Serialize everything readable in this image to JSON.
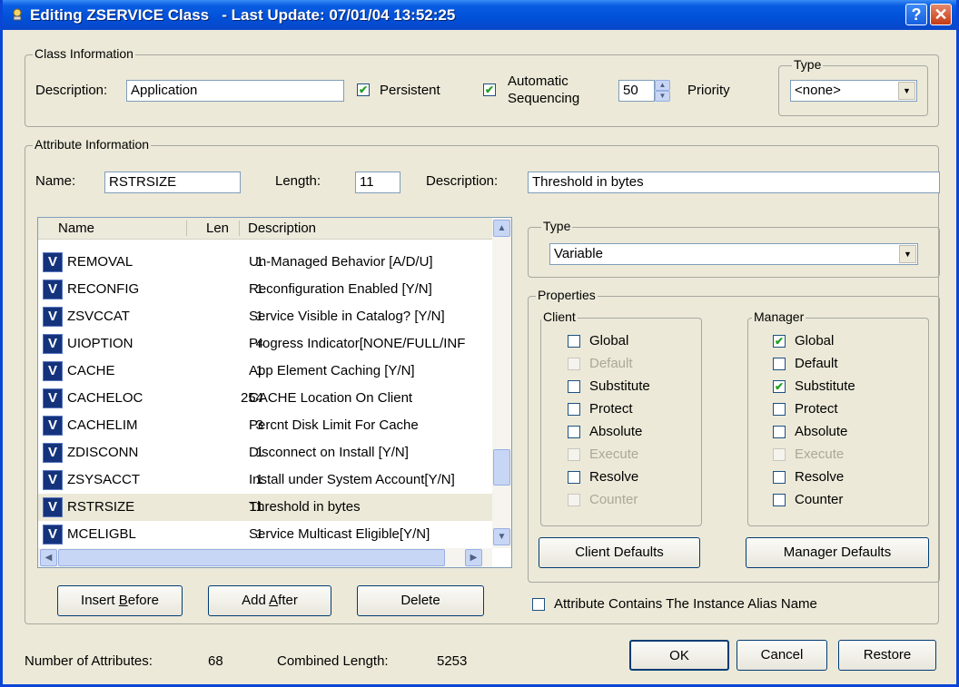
{
  "window": {
    "title": "Editing ZSERVICE Class   - Last Update: 07/01/04 13:52:25",
    "help_glyph": "?",
    "close_glyph": "✕"
  },
  "class_info": {
    "legend": "Class Information",
    "description_label": "Description:",
    "description_value": "Application",
    "persistent_label": "Persistent",
    "persistent_checked": true,
    "auto_seq_label_1": "Automatic",
    "auto_seq_label_2": "Sequencing",
    "auto_seq_checked": true,
    "priority_value": "50",
    "priority_label": "Priority",
    "type_legend": "Type",
    "type_value": "<none>"
  },
  "attr_info": {
    "legend": "Attribute Information",
    "name_label": "Name:",
    "name_value": "RSTRSIZE",
    "length_label": "Length:",
    "length_value": "11",
    "description_label": "Description:",
    "description_value": "Threshold in bytes"
  },
  "list": {
    "columns": [
      "Name",
      "Len",
      "Description"
    ],
    "rows": [
      {
        "icon": "V",
        "name": "REMOVAL",
        "len": "1",
        "desc": "Un-Managed Behavior [A/D/U]"
      },
      {
        "icon": "V",
        "name": "RECONFIG",
        "len": "1",
        "desc": "Reconfiguration  Enabled [Y/N]"
      },
      {
        "icon": "V",
        "name": "ZSVCCAT",
        "len": "1",
        "desc": "Service Visible in Catalog?  [Y/N]"
      },
      {
        "icon": "V",
        "name": "UIOPTION",
        "len": "4",
        "desc": "Progress Indicator[NONE/FULL/INF"
      },
      {
        "icon": "V",
        "name": "CACHE",
        "len": "1",
        "desc": "App Element Caching [Y/N]"
      },
      {
        "icon": "V",
        "name": "CACHELOC",
        "len": "254",
        "desc": "CACHE Location On Client"
      },
      {
        "icon": "V",
        "name": "CACHELIM",
        "len": "3",
        "desc": "Percnt Disk Limit For Cache"
      },
      {
        "icon": "V",
        "name": "ZDISCONN",
        "len": "1",
        "desc": "Disconnect on Install [Y/N]"
      },
      {
        "icon": "V",
        "name": "ZSYSACCT",
        "len": "1",
        "desc": "Install under System Account[Y/N]"
      },
      {
        "icon": "V",
        "name": "RSTRSIZE",
        "len": "11",
        "desc": "Threshold in bytes"
      },
      {
        "icon": "V",
        "name": "MCELIGBL",
        "len": "1",
        "desc": "Service Multicast Eligible[Y/N]"
      }
    ],
    "selected_index": 9
  },
  "type_group": {
    "legend": "Type",
    "value": "Variable"
  },
  "properties": {
    "legend": "Properties",
    "client_legend": "Client",
    "manager_legend": "Manager",
    "client": [
      {
        "label": "Global",
        "checked": false,
        "enabled": true
      },
      {
        "label": "Default",
        "checked": false,
        "enabled": false
      },
      {
        "label": "Substitute",
        "checked": false,
        "enabled": true
      },
      {
        "label": "Protect",
        "checked": false,
        "enabled": true
      },
      {
        "label": "Absolute",
        "checked": false,
        "enabled": true
      },
      {
        "label": "Execute",
        "checked": false,
        "enabled": false
      },
      {
        "label": "Resolve",
        "checked": false,
        "enabled": true
      },
      {
        "label": "Counter",
        "checked": false,
        "enabled": false
      }
    ],
    "manager": [
      {
        "label": "Global",
        "checked": true,
        "enabled": true
      },
      {
        "label": "Default",
        "checked": false,
        "enabled": true
      },
      {
        "label": "Substitute",
        "checked": true,
        "enabled": true
      },
      {
        "label": "Protect",
        "checked": false,
        "enabled": true
      },
      {
        "label": "Absolute",
        "checked": false,
        "enabled": true
      },
      {
        "label": "Execute",
        "checked": false,
        "enabled": false
      },
      {
        "label": "Resolve",
        "checked": false,
        "enabled": true
      },
      {
        "label": "Counter",
        "checked": false,
        "enabled": true
      }
    ],
    "client_defaults_label": "Client Defaults",
    "manager_defaults_label": "Manager Defaults"
  },
  "alias_checkbox": {
    "label": "Attribute Contains The Instance Alias Name",
    "checked": false
  },
  "buttons": {
    "insert_before_pre": "Insert ",
    "insert_before_u": "B",
    "insert_before_post": "efore",
    "add_after_pre": "Add ",
    "add_after_u": "A",
    "add_after_post": "fter",
    "delete": "Delete",
    "ok": "OK",
    "cancel": "Cancel",
    "restore": "Restore"
  },
  "footer": {
    "num_attr_label": "Number of Attributes:",
    "num_attr_value": "68",
    "combined_label": "Combined Length:",
    "combined_value": "5253"
  }
}
